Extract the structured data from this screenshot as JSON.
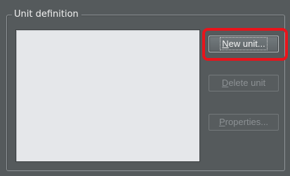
{
  "group": {
    "title": "Unit definition"
  },
  "buttons": {
    "new_unit": {
      "mnemonic": "N",
      "rest": "ew unit..."
    },
    "delete_unit": {
      "mnemonic": "D",
      "rest": "elete unit"
    },
    "properties": {
      "mnemonic": "P",
      "rest": "roperties..."
    }
  },
  "colors": {
    "highlight": "#e8141b",
    "list_background": "#e5e7ea",
    "panel_background": "#555a5c"
  },
  "states": {
    "delete_unit_enabled": false,
    "properties_enabled": false
  }
}
